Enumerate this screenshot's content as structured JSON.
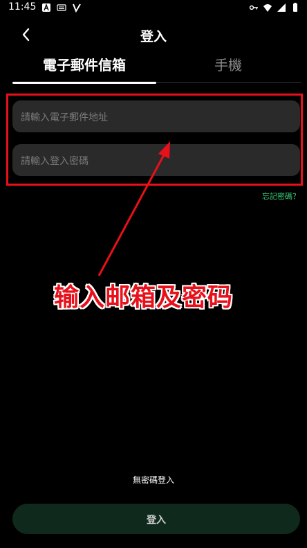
{
  "status_bar": {
    "time": "11:45",
    "icons_left": [
      "a-icon",
      "keyboard-icon",
      "v-icon"
    ],
    "icons_right": [
      "key-icon",
      "wifi-icon",
      "signal-icon",
      "battery-icon"
    ]
  },
  "header": {
    "title": "登入",
    "back_icon": "chevron-left-icon"
  },
  "tabs": [
    {
      "label": "電子郵件信箱",
      "active": true
    },
    {
      "label": "手機",
      "active": false
    }
  ],
  "form": {
    "email_placeholder": "請輸入電子郵件地址",
    "password_placeholder": "請輸入登入密碼",
    "forgot_password": "忘記密碼？"
  },
  "annotation": {
    "text": "输入邮箱及密码",
    "color": "#e8101a"
  },
  "footer": {
    "passwordless_login": "無密碼登入",
    "login_button": "登入"
  },
  "colors": {
    "accent": "#3ad07a",
    "button_bg": "#0f2a1c",
    "highlight": "#e8101a"
  }
}
